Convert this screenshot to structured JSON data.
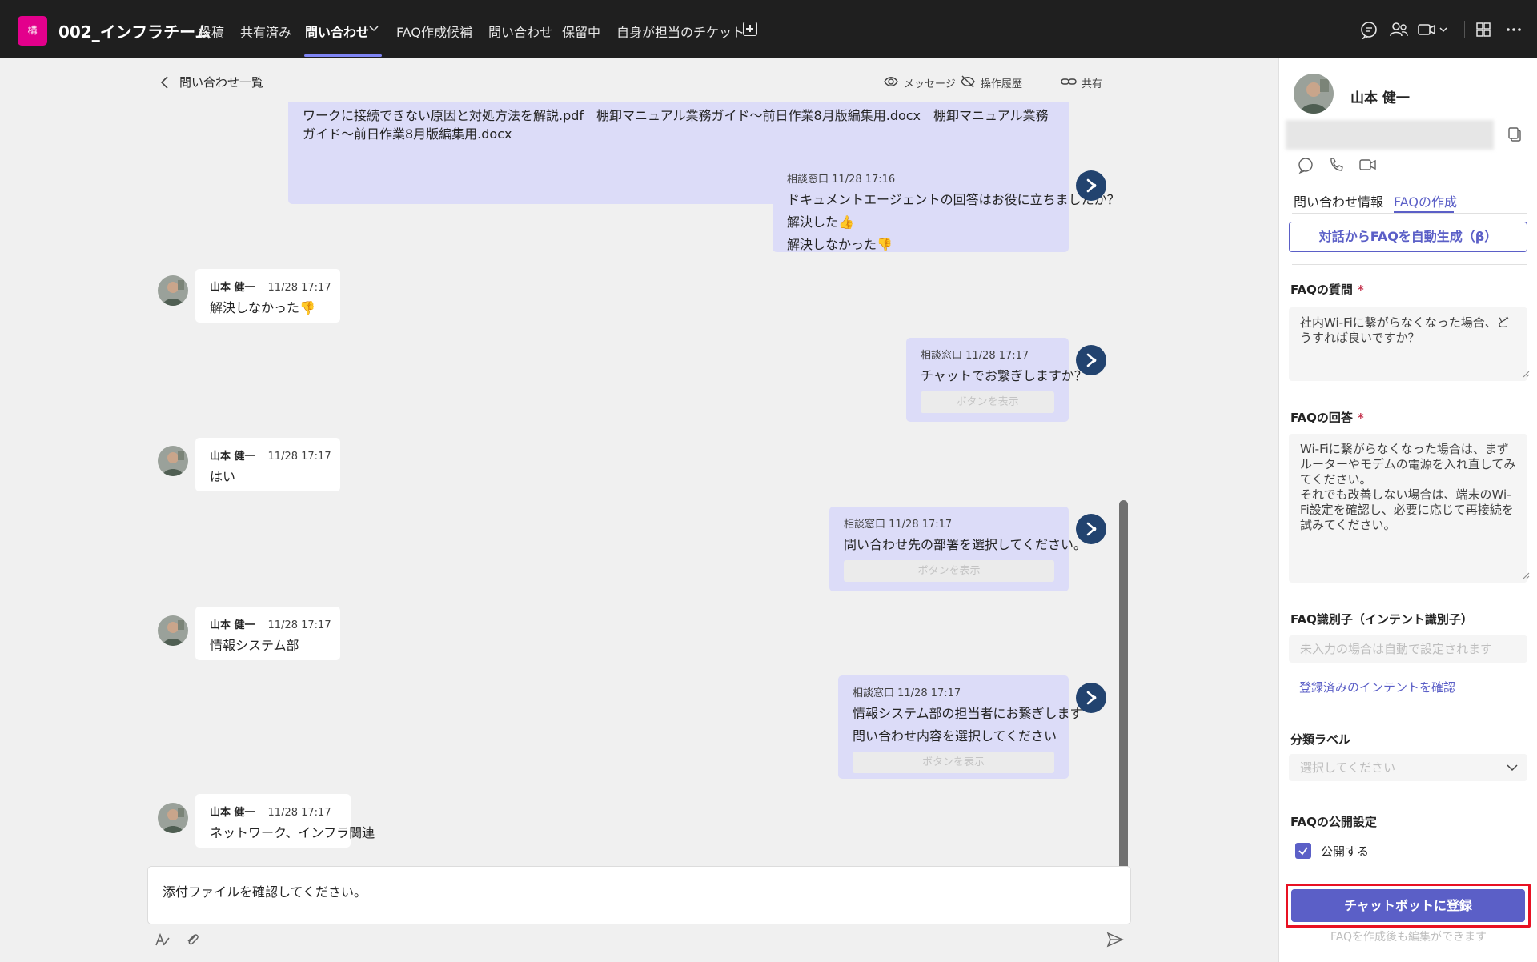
{
  "header": {
    "team_logo_text": "構",
    "team_name": "002_インフラチーム",
    "tabs": [
      {
        "label": "投稿"
      },
      {
        "label": "共有済み"
      },
      {
        "label": "問い合わせ"
      },
      {
        "label": "FAQ作成候補"
      },
      {
        "label": "問い合わせ"
      },
      {
        "label": "保留中"
      },
      {
        "label": "自身が担当のチケット"
      }
    ]
  },
  "chat": {
    "back_label": "問い合わせ一覧",
    "actions": {
      "message": "メッセージ",
      "history": "操作履歴",
      "share": "共有"
    },
    "file_message": "ワークに接続できない原因と対処方法を解説.pdf　棚卸マニュアル業務ガイド～前日作業8月版編集用.docx　棚卸マニュアル業務ガイド～前日作業8月版編集用.docx",
    "bot_messages": [
      {
        "meta": "相談窓口 11/28 17:16",
        "lines": [
          "ドキュメントエージェントの回答はお役に立ちましたか？",
          "解決した👍",
          "解決しなかった👎"
        ]
      },
      {
        "meta": "相談窓口 11/28 17:17",
        "lines": [
          "チャットでお繋ぎしますか？"
        ],
        "button": "ボタンを表示"
      },
      {
        "meta": "相談窓口 11/28 17:17",
        "lines": [
          "問い合わせ先の部署を選択してください。"
        ],
        "button": "ボタンを表示"
      },
      {
        "meta": "相談窓口 11/28 17:17",
        "lines": [
          "情報システム部の担当者にお繋ぎします",
          "問い合わせ内容を選択してください"
        ],
        "button": "ボタンを表示"
      }
    ],
    "user_messages": [
      {
        "name": "山本 健一",
        "time": "11/28 17:17",
        "text": "解決しなかった👎"
      },
      {
        "name": "山本 健一",
        "time": "11/28 17:17",
        "text": "はい"
      },
      {
        "name": "山本 健一",
        "time": "11/28 17:17",
        "text": "情報システム部"
      },
      {
        "name": "山本 健一",
        "time": "11/28 17:17",
        "text": "ネットワーク、インフラ関連"
      }
    ],
    "composer_text": "添付ファイルを確認してください。"
  },
  "panel": {
    "user_name": "山本 健一",
    "tabs": {
      "info": "問い合わせ情報",
      "faq": "FAQの作成"
    },
    "auto_generate_button": "対話からFAQを自動生成（β）",
    "question_label": "FAQの質問",
    "question_value": "社内Wi-Fiに繋がらなくなった場合、どうすれば良いですか？",
    "answer_label": "FAQの回答",
    "answer_value": "Wi-Fiに繋がらなくなった場合は、まずルーターやモデムの電源を入れ直してみてください。\nそれでも改善しない場合は、端末のWi-Fi設定を確認し、必要に応じて再接続を試みてください。",
    "intent_label": "FAQ識別子（インテント識別子）",
    "intent_placeholder": "未入力の場合は自動で設定されます",
    "intent_link": "登録済みのインテントを確認",
    "category_label": "分類ラベル",
    "category_placeholder": "選択してください",
    "publish_label": "FAQの公開設定",
    "publish_checkbox_label": "公開する",
    "publish_checked": true,
    "submit_button": "チャットボットに登録",
    "note": "FAQを作成後も編集ができます"
  },
  "colors": {
    "accent": "#5b5fc7",
    "bot_bubble": "#dcdcf8",
    "bot_icon": "#22436f",
    "highlight": "#e81123"
  }
}
